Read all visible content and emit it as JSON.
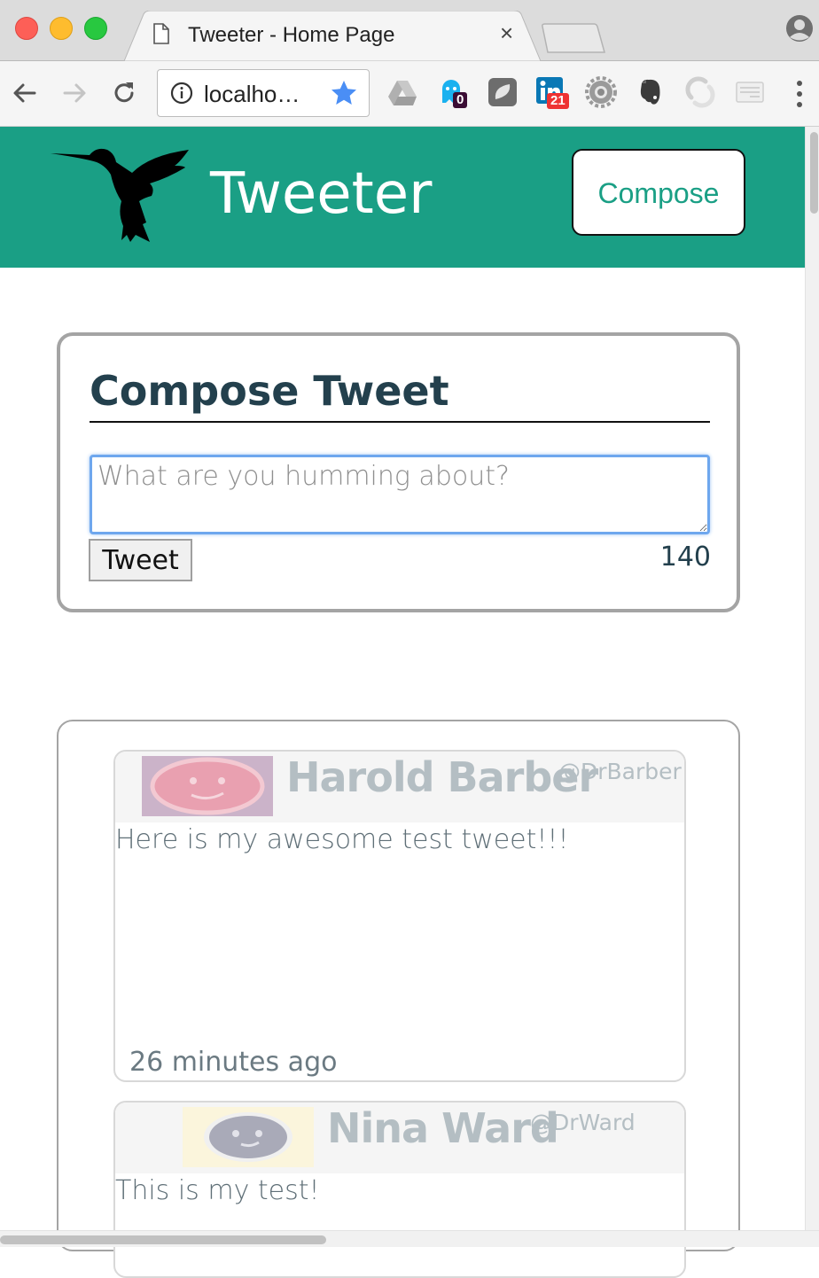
{
  "browser": {
    "tab_title": "Tweeter - Home Page",
    "tab_close": "×",
    "url": "localho…",
    "extensions": [
      {
        "name": "google-drive-icon"
      },
      {
        "name": "ghostery-icon",
        "badge": "0"
      },
      {
        "name": "shield-extension-icon"
      },
      {
        "name": "linkedin-icon",
        "badge": "21"
      },
      {
        "name": "settings-gear-icon"
      },
      {
        "name": "evernote-icon"
      },
      {
        "name": "sync-extension-icon"
      },
      {
        "name": "reader-extension-icon"
      }
    ]
  },
  "header": {
    "brand": "Tweeter",
    "compose_label": "Compose",
    "accent_color": "#1a9f85"
  },
  "composer": {
    "heading": "Compose Tweet",
    "placeholder": "What are you humming about?",
    "value": "",
    "submit_label": "Tweet",
    "counter": "140"
  },
  "tweets": [
    {
      "name": "Harold Barber",
      "handle": "@DrBarber",
      "content": "Here is my awesome test tweet!!!",
      "time": "26 minutes ago",
      "avatar_color": "#e9a0b0"
    },
    {
      "name": "Nina Ward",
      "handle": "@DrWard",
      "content": "This is my test!",
      "time": "",
      "avatar_color": "#b3b3c3"
    }
  ]
}
